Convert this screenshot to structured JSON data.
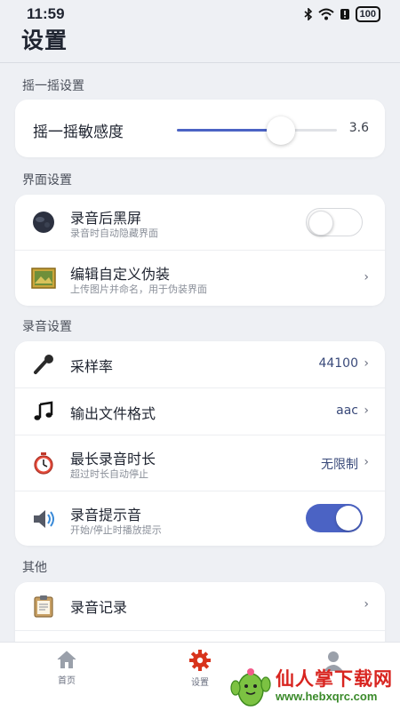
{
  "status_bar": {
    "time": "11:59",
    "battery": "100"
  },
  "header": {
    "title": "设置"
  },
  "sections": {
    "shake": {
      "title": "摇一摇设置",
      "sensitivity_label": "摇一摇敏感度",
      "sensitivity_value": "3.6",
      "sensitivity_fraction": 0.65
    },
    "interface": {
      "title": "界面设置",
      "black_screen": {
        "title": "录音后黑屏",
        "subtitle": "录音时自动隐藏界面",
        "enabled": false
      },
      "disguise": {
        "title": "编辑自定义伪装",
        "subtitle": "上传图片并命名，用于伪装界面"
      }
    },
    "recording": {
      "title": "录音设置",
      "sample_rate": {
        "title": "采样率",
        "value": "44100"
      },
      "format": {
        "title": "输出文件格式",
        "value": "aac"
      },
      "max_duration": {
        "title": "最长录音时长",
        "subtitle": "超过时长自动停止",
        "value": "无限制"
      },
      "prompt_sound": {
        "title": "录音提示音",
        "subtitle": "开始/停止时播放提示",
        "enabled": true
      }
    },
    "other": {
      "title": "其他",
      "records": {
        "title": "录音记录"
      }
    }
  },
  "bottom_nav": {
    "home": "首页",
    "settings": "设置"
  },
  "watermark": {
    "text": "仙人掌下载网",
    "url": "www.hebxqrc.com"
  },
  "colors": {
    "accent": "#4b63c4",
    "settings_icon": "#d8341c",
    "background": "#eef0f4"
  }
}
